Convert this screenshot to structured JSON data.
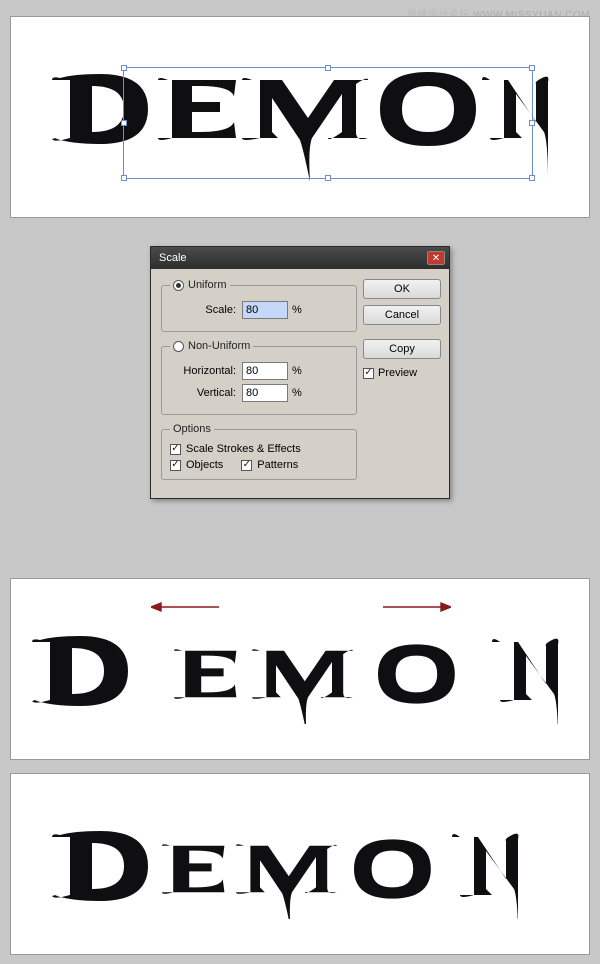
{
  "watermark": {
    "text_cn": "思缘设计论坛",
    "text_en": "WWW.MISSYUAN.COM"
  },
  "dialog": {
    "title": "Scale",
    "uniform": {
      "legend": "Uniform",
      "scale_label": "Scale:",
      "scale_value": "80",
      "pct": "%"
    },
    "nonuniform": {
      "legend": "Non-Uniform",
      "h_label": "Horizontal:",
      "h_value": "80",
      "v_label": "Vertical:",
      "v_value": "80",
      "pct": "%"
    },
    "options": {
      "legend": "Options",
      "scale_strokes": "Scale Strokes & Effects",
      "objects": "Objects",
      "patterns": "Patterns"
    },
    "buttons": {
      "ok": "OK",
      "cancel": "Cancel",
      "copy": "Copy",
      "preview": "Preview"
    }
  },
  "artwork": {
    "word": "DEMON",
    "color": "#0f0f12"
  }
}
